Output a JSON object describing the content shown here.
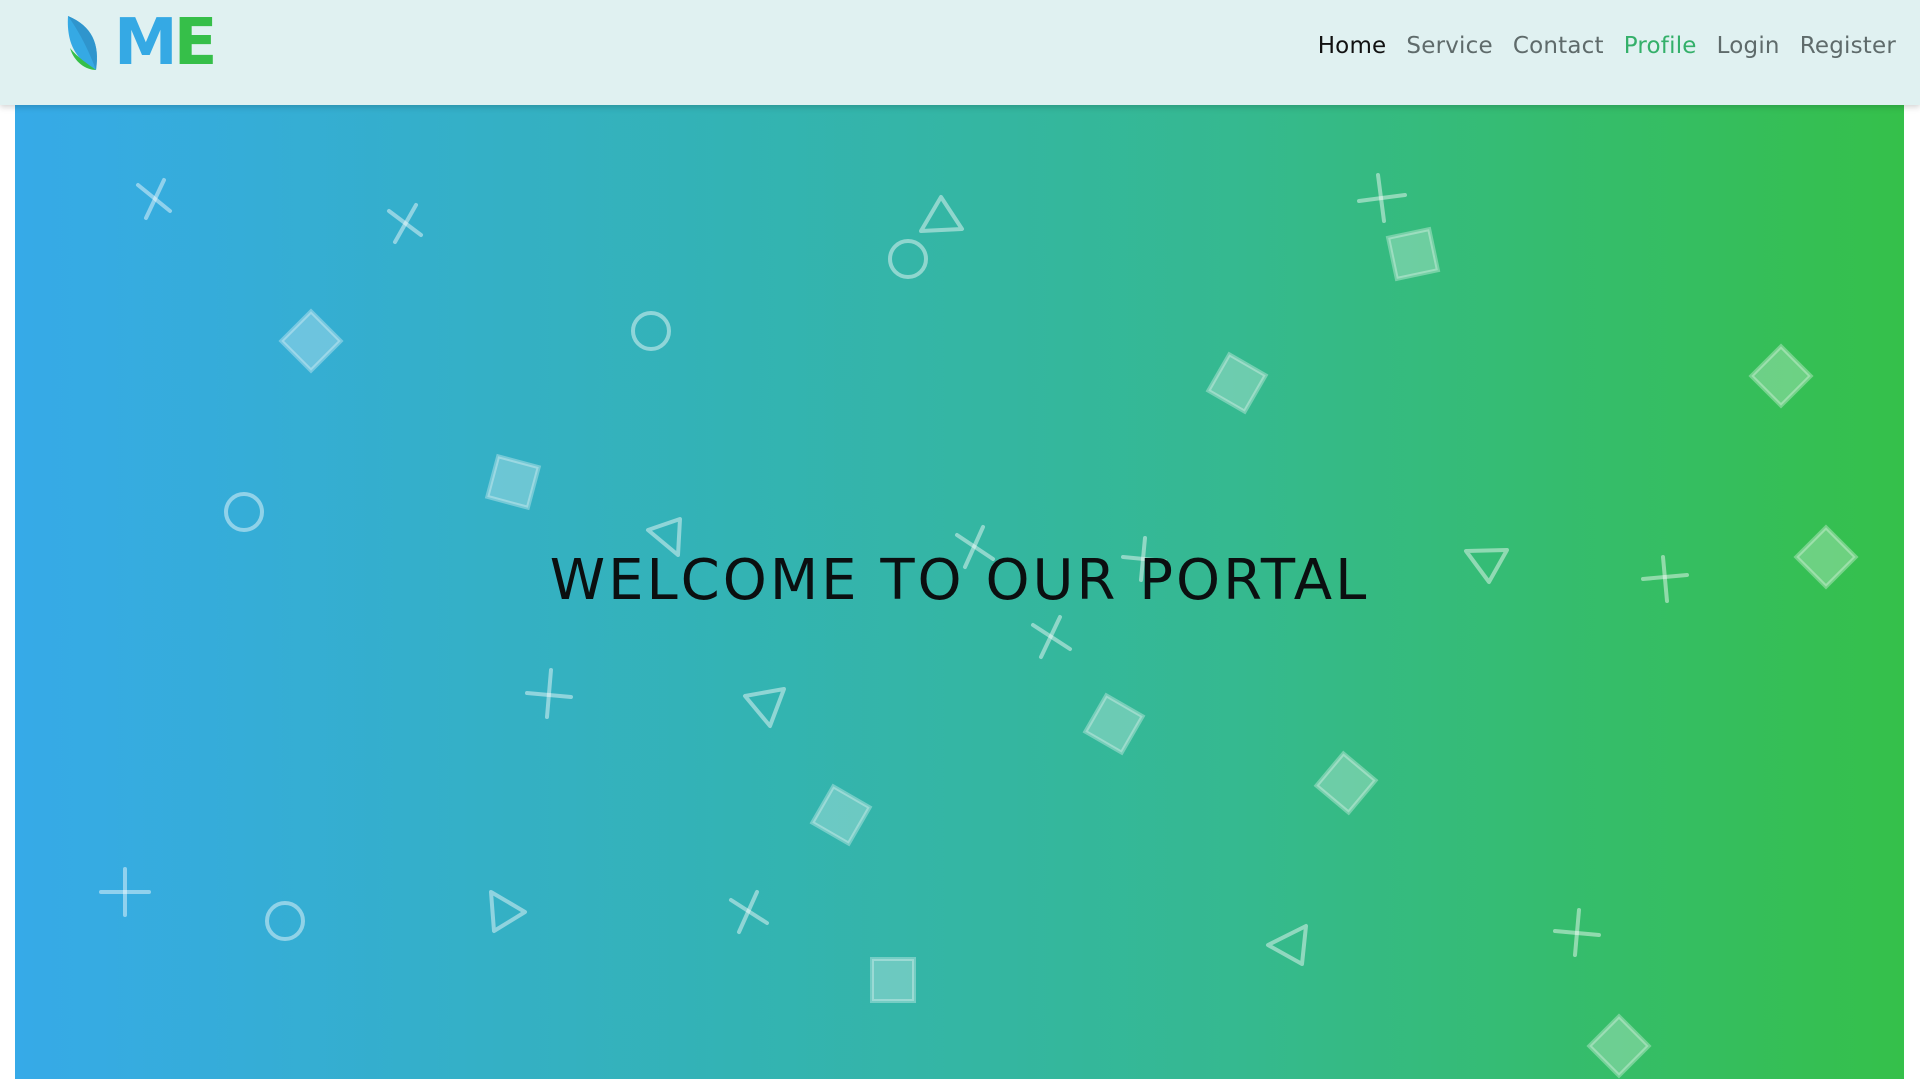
{
  "brand": {
    "logo_icon": "leaf-logo-icon",
    "logo_text_1": "M",
    "logo_text_2": "E",
    "colors": {
      "blue": "#35a9e4",
      "green": "#36bf49"
    }
  },
  "nav": {
    "items": [
      {
        "label": "Home",
        "state": "active"
      },
      {
        "label": "Service",
        "state": "normal"
      },
      {
        "label": "Contact",
        "state": "normal"
      },
      {
        "label": "Profile",
        "state": "highlighted"
      },
      {
        "label": "Login",
        "state": "normal"
      },
      {
        "label": "Register",
        "state": "normal"
      }
    ]
  },
  "hero": {
    "title": "WELCOME TO OUR PORTAL",
    "gradient": [
      "#36aae8",
      "#33b3b4",
      "#35b98f",
      "#35c04a"
    ],
    "decor_shapes": [
      "cross-icon",
      "plus-icon",
      "circle-icon",
      "triangle-icon",
      "diamond-icon"
    ]
  }
}
